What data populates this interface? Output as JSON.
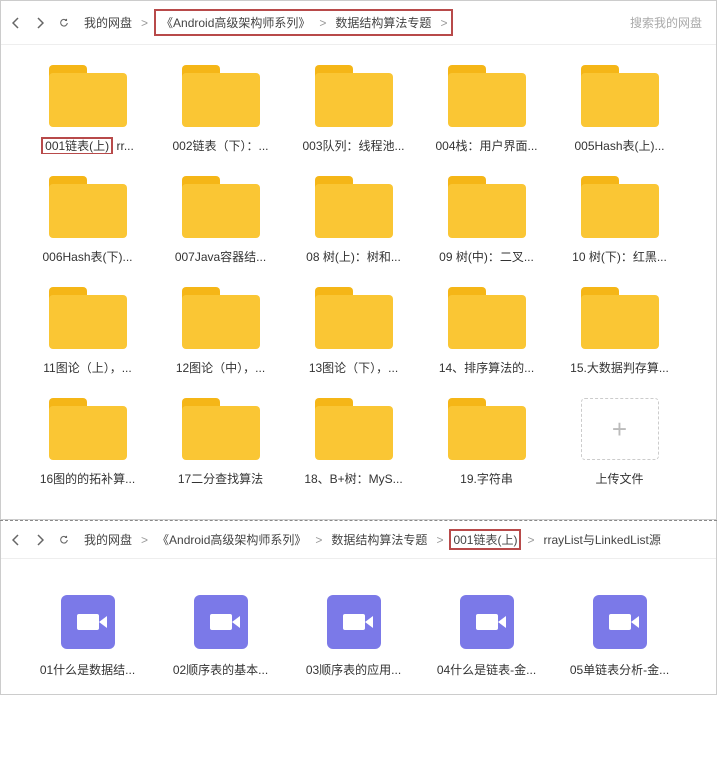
{
  "top": {
    "breadcrumb": {
      "root": "我的网盘",
      "seg1": "《Android高级架构师系列》",
      "seg2": "数据结构算法专题"
    },
    "search_placeholder": "搜索我的网盘",
    "folders": [
      {
        "name": "001链表(上)",
        "trail": "rr...",
        "highlight": true
      },
      {
        "name": "002链表（下）：...",
        "highlight": false
      },
      {
        "name": "003队列：线程池...",
        "highlight": false
      },
      {
        "name": "004栈：用户界面...",
        "highlight": false
      },
      {
        "name": "005Hash表(上)...",
        "highlight": false
      },
      {
        "name": "006Hash表(下)...",
        "highlight": false
      },
      {
        "name": "007Java容器结...",
        "highlight": false
      },
      {
        "name": "08 树(上)：树和...",
        "highlight": false
      },
      {
        "name": "09 树(中)：二叉...",
        "highlight": false
      },
      {
        "name": "10 树(下)：红黑...",
        "highlight": false
      },
      {
        "name": "11图论（上），...",
        "highlight": false
      },
      {
        "name": "12图论（中），...",
        "highlight": false
      },
      {
        "name": "13图论（下），...",
        "highlight": false
      },
      {
        "name": "14、排序算法的...",
        "highlight": false
      },
      {
        "name": "15.大数据判存算...",
        "highlight": false
      },
      {
        "name": "16图的的拓补算...",
        "highlight": false
      },
      {
        "name": "17二分查找算法",
        "highlight": false
      },
      {
        "name": "18、B+树：MyS...",
        "highlight": false
      },
      {
        "name": "19.字符串",
        "highlight": false
      }
    ],
    "upload_label": "上传文件"
  },
  "bottom": {
    "breadcrumb": {
      "root": "我的网盘",
      "seg1": "《Android高级架构师系列》",
      "seg2": "数据结构算法专题",
      "seg3": "001链表(上)",
      "trail": "rrayList与LinkedList源"
    },
    "videos": [
      {
        "name": "01什么是数据结..."
      },
      {
        "name": "02顺序表的基本..."
      },
      {
        "name": "03顺序表的应用..."
      },
      {
        "name": "04什么是链表-金..."
      },
      {
        "name": "05单链表分析-金..."
      }
    ]
  }
}
